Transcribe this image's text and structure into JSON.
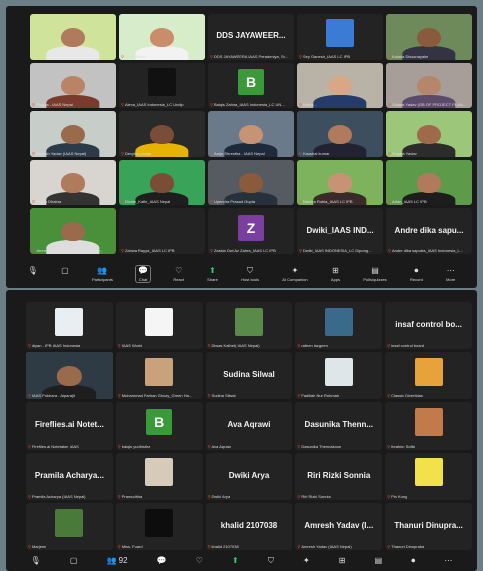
{
  "meeting1": {
    "tiles": [
      {
        "label": "",
        "kind": "video",
        "bg": "#cfe39a",
        "skin": "#b07a5c",
        "shirt": "#e8e8e8",
        "active": false
      },
      {
        "label": "IAAS World",
        "kind": "video",
        "bg": "#d7ecc8",
        "skin": "#c98d6a",
        "shirt": "#f2f2f2",
        "active": true
      },
      {
        "label": "DDS JAYAWEERA IAAS Peradeniya, Sr...",
        "kind": "name",
        "name": "DDS JAYAWEER...",
        "active": false
      },
      {
        "label": "Sey Ganesh_IAAS LC IPB",
        "kind": "photo",
        "bg": "#3a7bd5",
        "active": false
      },
      {
        "label": "Kalana Dissanayake",
        "kind": "video",
        "bg": "#6f8a5a",
        "skin": "#8a5a3c",
        "shirt": "#334",
        "active": false
      },
      {
        "label": "Pragya - IAAS Nepal",
        "kind": "video",
        "bg": "#c2c2c2",
        "skin": "#b98466",
        "shirt": "#7a3b2e",
        "active": false
      },
      {
        "label": "Alexa_IAAS Indonesia_LC Undip",
        "kind": "photo",
        "bg": "#111",
        "active": false
      },
      {
        "label": "Balqis Zahira_IAAS Indonesia_LC UN...",
        "kind": "avatar",
        "letter": "B",
        "color": "#3a9a3a",
        "active": false
      },
      {
        "label": "Nadia...",
        "kind": "video",
        "bg": "#b9b2a6",
        "skin": "#d7a786",
        "shirt": "#243b6b",
        "active": false
      },
      {
        "label": "Srijana Yadav (GB OF PROJECT PLAN...",
        "kind": "video",
        "bg": "#a79e99",
        "skin": "#b6866a",
        "shirt": "#5c4a6a",
        "active": false
      },
      {
        "label": "Amresh Yadav (IAAS Nepal)",
        "kind": "video",
        "bg": "#c7cec9",
        "skin": "#9a6a4c",
        "shirt": "#2d3a4a",
        "active": false
      },
      {
        "label": "Devyika panjar",
        "kind": "video",
        "bg": "#2a2a2a",
        "skin": "#7a4e36",
        "shirt": "#e6b400",
        "active": false
      },
      {
        "label": "Aarju Shrestha - IAAS Nepal",
        "kind": "video",
        "bg": "#6a7a8a",
        "skin": "#c69474",
        "shirt": "#1e2a3a",
        "active": false
      },
      {
        "label": "Kaushal kumar",
        "kind": "video",
        "bg": "#3d4e5e",
        "skin": "#b07a5c",
        "shirt": "#223",
        "active": false
      },
      {
        "label": "Sugata Yadav",
        "kind": "video",
        "bg": "#9cc77a",
        "skin": "#9e6a4a",
        "shirt": "#2c2c2c",
        "active": false
      },
      {
        "label": "Zayan Dhabra",
        "kind": "video",
        "bg": "#d8d4cf",
        "skin": "#b07a5c",
        "shirt": "#333",
        "active": false
      },
      {
        "label": "Divide_Kafle_IAAS Nepal",
        "kind": "video",
        "bg": "#3aa35a",
        "skin": "#7a4e36",
        "shirt": "#1e1e1e",
        "active": false
      },
      {
        "label": "Upendra Prasad Gupta",
        "kind": "video",
        "bg": "#555b61",
        "skin": "#8a5a3c",
        "shirt": "#26313c",
        "active": false
      },
      {
        "label": "Namira Rubla_IAAS LC IPB",
        "kind": "video",
        "bg": "#7cb35c",
        "skin": "#c69474",
        "shirt": "#3a2a2a",
        "active": false
      },
      {
        "label": "Arfan_IAAS LC IPB",
        "kind": "video",
        "bg": "#5d9b4a",
        "skin": "#b07a5c",
        "shirt": "#1d1d1d",
        "active": false
      },
      {
        "label": "Jeremy_IAAS Indonesia_LC Dipone...",
        "kind": "video",
        "bg": "#4a8f3a",
        "skin": "#9a6a4c",
        "shirt": "#ddd",
        "active": false
      },
      {
        "label": "Zahwa Rayya_IAAS LC IPB",
        "kind": "blank",
        "active": false
      },
      {
        "label": "Zaskia Dwi Az Zahra_IAAS LC IPB",
        "kind": "avatar",
        "letter": "Z",
        "color": "#7b3fa0",
        "active": false
      },
      {
        "label": "Dwiki_IAAS INDONESIA_LC Dipong...",
        "kind": "name",
        "name": "Dwiki_IAAS IND...",
        "active": false
      },
      {
        "label": "Andre dika saputra_IAAS Indonesia_L...",
        "kind": "name",
        "name": "Andre dika sapu...",
        "active": false
      }
    ],
    "toolbar": [
      {
        "icon": "🎙",
        "label": "",
        "name": "mute"
      },
      {
        "icon": "▢",
        "label": "",
        "name": "video"
      },
      {
        "icon": "👥",
        "label": "Participants",
        "name": "participants"
      },
      {
        "icon": "💬",
        "label": "Chat",
        "name": "chat"
      },
      {
        "icon": "♡",
        "label": "React",
        "name": "react"
      },
      {
        "icon": "⬆",
        "label": "Share",
        "name": "share"
      },
      {
        "icon": "⛉",
        "label": "Host tools",
        "name": "host-tools"
      },
      {
        "icon": "✦",
        "label": "AI Companion",
        "name": "ai-companion"
      },
      {
        "icon": "⊞",
        "label": "Apps",
        "name": "apps"
      },
      {
        "icon": "▤",
        "label": "Polls/quizzes",
        "name": "polls"
      },
      {
        "icon": "⏺",
        "label": "Record",
        "name": "record"
      },
      {
        "icon": "⋯",
        "label": "More",
        "name": "more"
      }
    ]
  },
  "meeting2": {
    "tiles": [
      {
        "label": "diyan - IPB IAAS Indonesia",
        "kind": "photo",
        "bg": "#e8eef2",
        "active": false
      },
      {
        "label": "IAAS World",
        "kind": "photo",
        "bg": "#f5f5f5",
        "active": false
      },
      {
        "label": "Diwas Kathet( IAAS Nepal)",
        "kind": "photo",
        "bg": "#5a8a4a",
        "active": false
      },
      {
        "label": "rafeen lazgeen",
        "kind": "photo",
        "bg": "#3a6a8a",
        "active": false
      },
      {
        "label": "insaf control board",
        "kind": "name",
        "name": "insaf control bo...",
        "active": false
      },
      {
        "label": "IAAS Pokhara - Aiparajit",
        "kind": "video",
        "bg": "#2e3a44",
        "skin": "#9a6a4c",
        "shirt": "#1e1e1e",
        "active": true
      },
      {
        "label": "Muhammad Farhan Ghozy_Green Ha...",
        "kind": "photo",
        "bg": "#c9a17a",
        "active": false
      },
      {
        "label": "Sudina Silwal",
        "kind": "name",
        "name": "Sudina Silwal",
        "active": false
      },
      {
        "label": "Fadillah Nur Rohmah",
        "kind": "photo",
        "bg": "#dfe6ea",
        "active": false
      },
      {
        "label": "Classic Divertidas",
        "kind": "photo",
        "bg": "#e8a23a",
        "active": false
      },
      {
        "label": "Fireflies.ai Notetaker IAAS",
        "kind": "name",
        "name": "Fireflies.ai Notet...",
        "active": false
      },
      {
        "label": "balqis yudhistira",
        "kind": "avatar",
        "letter": "B",
        "color": "#3a9a3a",
        "active": false
      },
      {
        "label": "Ava Aqrawi",
        "kind": "name",
        "name": "Ava Aqrawi",
        "active": false
      },
      {
        "label": "Dasunika Thennakoon",
        "kind": "name",
        "name": "Dasunika Thenn...",
        "active": false
      },
      {
        "label": "Ibrahim Sofiki",
        "kind": "photo",
        "bg": "#c27a4a",
        "active": false
      },
      {
        "label": "Pramila Acharya (IAAS Nepal)",
        "kind": "name",
        "name": "Pramila Acharya...",
        "active": false
      },
      {
        "label": "Pramuditha",
        "kind": "photo",
        "bg": "#d6cbb8",
        "active": false
      },
      {
        "label": "Dwiki Arya",
        "kind": "name",
        "name": "Dwiki Arya",
        "active": false
      },
      {
        "label": "Riri Rizki Sonnia",
        "kind": "name",
        "name": "Riri Rizki Sonnia",
        "active": false
      },
      {
        "label": "Pin Kung",
        "kind": "photo",
        "bg": "#f2e14a",
        "active": false
      },
      {
        "label": "Marjeen",
        "kind": "photo",
        "bg": "#4a7a3a",
        "active": false
      },
      {
        "label": "Miss. Fuard",
        "kind": "photo",
        "bg": "#0d0d0d",
        "active": false
      },
      {
        "label": "khalid 2107038",
        "kind": "name",
        "name": "khalid 2107038",
        "active": false
      },
      {
        "label": "Amresh Yadav (IAAS Nepal)",
        "kind": "name",
        "name": "Amresh Yadav (I...",
        "active": false
      },
      {
        "label": "Thanuri Dinupraba",
        "kind": "name",
        "name": "Thanuri Dinupra...",
        "active": false
      }
    ],
    "toolbar": [
      {
        "icon": "🎙",
        "label": "",
        "name": "mute"
      },
      {
        "icon": "▢",
        "label": "",
        "name": "video"
      },
      {
        "icon": "👥 92",
        "label": "",
        "name": "participants"
      },
      {
        "icon": "💬",
        "label": "",
        "name": "chat"
      },
      {
        "icon": "♡",
        "label": "",
        "name": "react"
      },
      {
        "icon": "⬆",
        "label": "",
        "name": "share"
      },
      {
        "icon": "⛉",
        "label": "",
        "name": "host-tools"
      },
      {
        "icon": "✦",
        "label": "",
        "name": "ai-companion"
      },
      {
        "icon": "⊞",
        "label": "",
        "name": "apps"
      },
      {
        "icon": "▤",
        "label": "",
        "name": "polls"
      },
      {
        "icon": "⏺",
        "label": "",
        "name": "record"
      },
      {
        "icon": "⋯",
        "label": "",
        "name": "more"
      }
    ]
  }
}
